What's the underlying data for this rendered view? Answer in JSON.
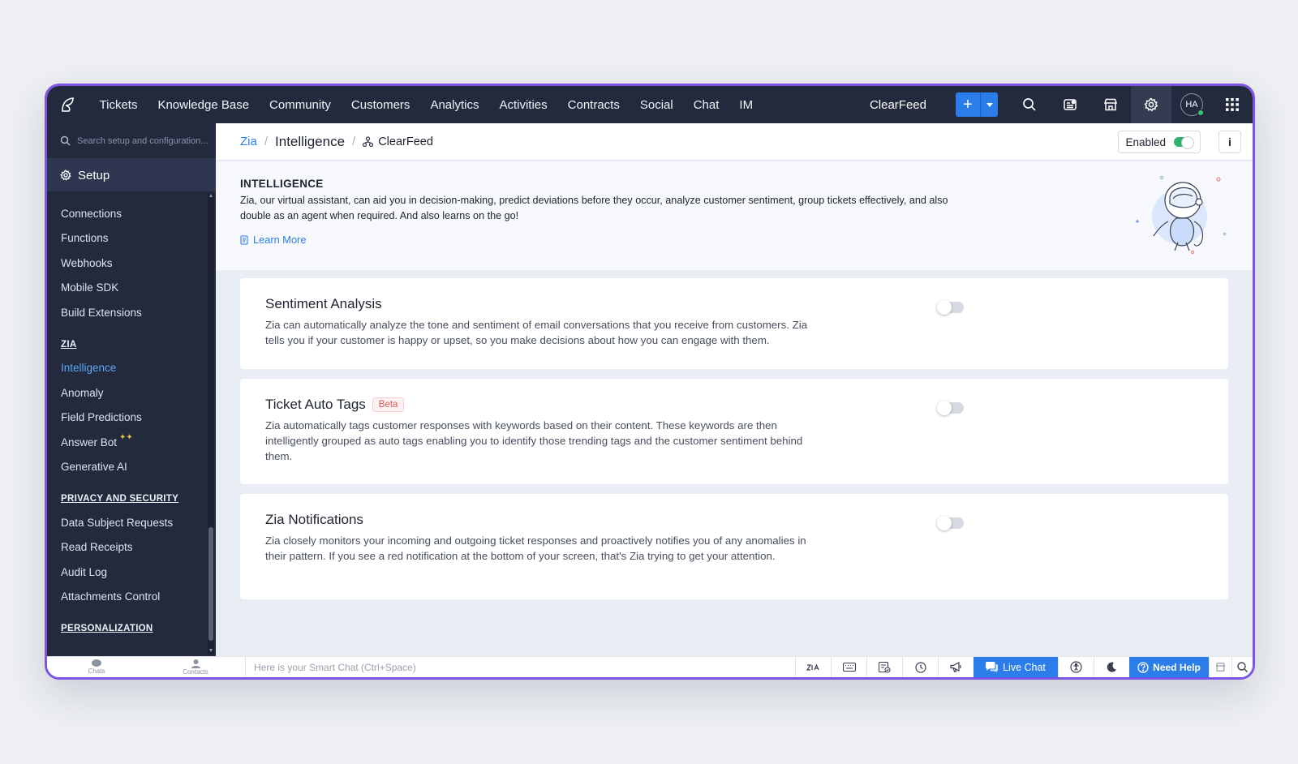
{
  "nav": {
    "items": [
      "Tickets",
      "Knowledge Base",
      "Community",
      "Customers",
      "Analytics",
      "Activities",
      "Contracts",
      "Social",
      "Chat",
      "IM"
    ],
    "org_name": "ClearFeed",
    "avatar_initials": "HA",
    "add_symbol": "+"
  },
  "sidebar": {
    "search_placeholder": "Search setup and configuration...",
    "setup_label": "Setup",
    "groups": [
      {
        "items": [
          "Connections",
          "Functions",
          "Webhooks",
          "Mobile SDK",
          "Build Extensions"
        ]
      }
    ],
    "zia_heading": "ZIA",
    "zia_items": [
      "Intelligence",
      "Anomaly",
      "Field Predictions",
      "Answer Bot",
      "Generative AI"
    ],
    "privacy_heading": "PRIVACY AND SECURITY",
    "privacy_items": [
      "Data Subject Requests",
      "Read Receipts",
      "Audit Log",
      "Attachments Control"
    ],
    "personalization_heading": "PERSONALIZATION"
  },
  "breadcrumb": {
    "root": "Zia",
    "current": "Intelligence",
    "last": "ClearFeed",
    "sep": "/"
  },
  "status": {
    "label": "Enabled",
    "enabled": true,
    "info_label": "i"
  },
  "intro": {
    "title": "INTELLIGENCE",
    "description": "Zia, our virtual assistant, can aid you in decision-making, predict deviations before they occur, analyze customer sentiment, group tickets effectively, and also double as an agent when required. And also learns on the go!",
    "learn_more": "Learn More"
  },
  "cards": [
    {
      "title": "Sentiment Analysis",
      "badge": "",
      "enabled": false,
      "description": "Zia can automatically analyze the tone and sentiment of email conversations that you receive from customers. Zia tells you if your customer is happy or upset, so you make decisions about how you can engage with them."
    },
    {
      "title": "Ticket Auto Tags",
      "badge": "Beta",
      "enabled": false,
      "description": "Zia automatically tags customer responses with keywords based on their content. These keywords are then intelligently grouped as auto tags enabling you to identify those trending tags and the customer sentiment behind them."
    },
    {
      "title": "Zia Notifications",
      "badge": "",
      "enabled": false,
      "description": "Zia closely monitors your incoming and outgoing ticket responses and proactively notifies you of any anomalies in their pattern. If you see a red notification at the bottom of your screen, that's Zia trying to get your attention."
    }
  ],
  "bottombar": {
    "chats": "Chats",
    "contacts": "Contacts",
    "smart_chat_placeholder": "Here is your Smart Chat (Ctrl+Space)",
    "live_chat": "Live Chat",
    "need_help": "Need Help"
  },
  "colors": {
    "accent": "#2b7de9",
    "nav_bg": "#232a3e",
    "window_border": "#7d55e6",
    "toggle_on": "#2fb36b"
  }
}
